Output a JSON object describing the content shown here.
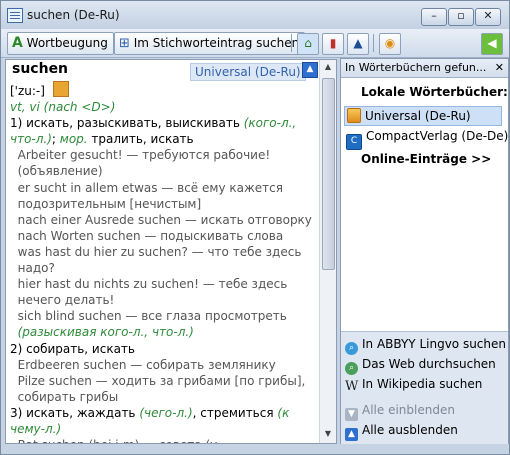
{
  "window": {
    "title": "suchen (De-Ru)"
  },
  "toolbar": {
    "wortbeugung_label": "Wortbeugung",
    "stichwort_label": "Im Stichworteintrag suchen"
  },
  "article": {
    "headword": "suchen",
    "dict_label": "Universal (De-Ru)",
    "transcription": "['zu:-]",
    "lines": [
      {
        "parts": [
          {
            "t": "vt, vi (nach <D>)",
            "c": "g"
          }
        ]
      },
      {
        "parts": [
          {
            "t": "1) искать, разыскивать, выискивать ",
            "c": ""
          },
          {
            "t": "(кого-л.,",
            "c": "g"
          }
        ]
      },
      {
        "parts": [
          {
            "t": "что-л.)",
            "c": "g"
          },
          {
            "t": "; ",
            "c": ""
          },
          {
            "t": "мор.",
            "c": "g"
          },
          {
            "t": " тралить, искать",
            "c": ""
          }
        ]
      },
      {
        "parts": [
          {
            "t": "  Arbeiter gesucht! — требуются рабочие!",
            "c": "ex"
          }
        ]
      },
      {
        "parts": [
          {
            "t": "  (объявление)",
            "c": "ex"
          }
        ]
      },
      {
        "parts": [
          {
            "t": "  er sucht in allem etwas — всё ему кажется",
            "c": "ex"
          }
        ]
      },
      {
        "parts": [
          {
            "t": "  подозрительным [нечистым]",
            "c": "ex"
          }
        ]
      },
      {
        "parts": [
          {
            "t": "  nach einer Ausrede suchen — искать отговорку",
            "c": "ex"
          }
        ]
      },
      {
        "parts": [
          {
            "t": "  nach Worten suchen — подыскивать слова",
            "c": "ex"
          }
        ]
      },
      {
        "parts": [
          {
            "t": "  was hast du hier zu suchen? — что тебе здесь",
            "c": "ex"
          }
        ]
      },
      {
        "parts": [
          {
            "t": "  надо?",
            "c": "ex"
          }
        ]
      },
      {
        "parts": [
          {
            "t": "  hier hast du nichts zu suchen! — тебе здесь",
            "c": "ex"
          }
        ]
      },
      {
        "parts": [
          {
            "t": "  нечего делать!",
            "c": "ex"
          }
        ]
      },
      {
        "parts": [
          {
            "t": "  sich blind suchen — все глаза просмотреть",
            "c": "ex"
          }
        ]
      },
      {
        "parts": [
          {
            "t": "  (разыскивая ",
            "c": "g"
          },
          {
            "t": "кого-л., ",
            "c": "g"
          },
          {
            "t": "что-л.)",
            "c": "g"
          }
        ]
      },
      {
        "parts": [
          {
            "t": "2) собирать, искать",
            "c": ""
          }
        ]
      },
      {
        "parts": [
          {
            "t": "  Erdbeeren suchen — собирать землянику",
            "c": "ex"
          }
        ]
      },
      {
        "parts": [
          {
            "t": "  Pilze suchen — ходить за грибами [по грибы],",
            "c": "ex"
          }
        ]
      },
      {
        "parts": [
          {
            "t": "  собирать грибы",
            "c": "ex"
          }
        ]
      },
      {
        "parts": [
          {
            "t": "3) искать, жаждать ",
            "c": ""
          },
          {
            "t": "(чего-л.)",
            "c": "g"
          },
          {
            "t": ", стремиться ",
            "c": ""
          },
          {
            "t": "(к",
            "c": "g"
          }
        ]
      },
      {
        "parts": [
          {
            "t": "чему-л.)",
            "c": "g"
          }
        ]
      },
      {
        "parts": [
          {
            "t": "  Rat suchen (bei j-m) — совета (у",
            "c": "ex"
          }
        ]
      }
    ]
  },
  "panel": {
    "header": "In Wörterbüchern gefun...",
    "local_title": "Lokale Wörterbücher:",
    "dicts": [
      "Universal (De-Ru)",
      "CompactVerlag (De-De)"
    ],
    "online": "Online-Einträge >>",
    "links": [
      "In ABBYY Lingvo suchen",
      "Das Web durchsuchen",
      "In Wikipedia suchen"
    ],
    "show_all": "Alle einblenden",
    "hide_all": "Alle ausblenden"
  }
}
